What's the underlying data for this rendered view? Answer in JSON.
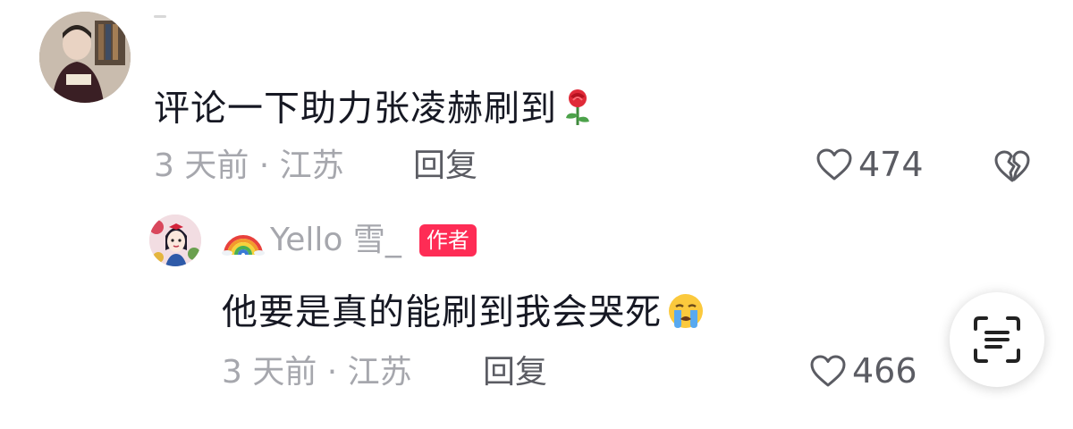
{
  "comment": {
    "text": "评论一下助力张凌赫刷到",
    "emoji_icon": "rose-emoji",
    "meta": "3 天前 · 江苏",
    "reply_label": "回复",
    "likes": "474",
    "dislike_icon": "broken-heart-icon"
  },
  "reply": {
    "name_prefix_icon": "rainbow-emoji",
    "name": "Yello 雪_",
    "author_tag": "作者",
    "text": "他要是真的能刷到我会哭死",
    "emoji_icon": "crying-face-emoji",
    "meta": "3 天前 · 江苏",
    "reply_label": "回复",
    "likes": "466"
  },
  "floating": {
    "icon": "scan-text-icon"
  },
  "colors": {
    "text": "#161823",
    "muted": "#a6a7ad",
    "secondary": "#5b5c63",
    "tag": "#fe2c55"
  }
}
